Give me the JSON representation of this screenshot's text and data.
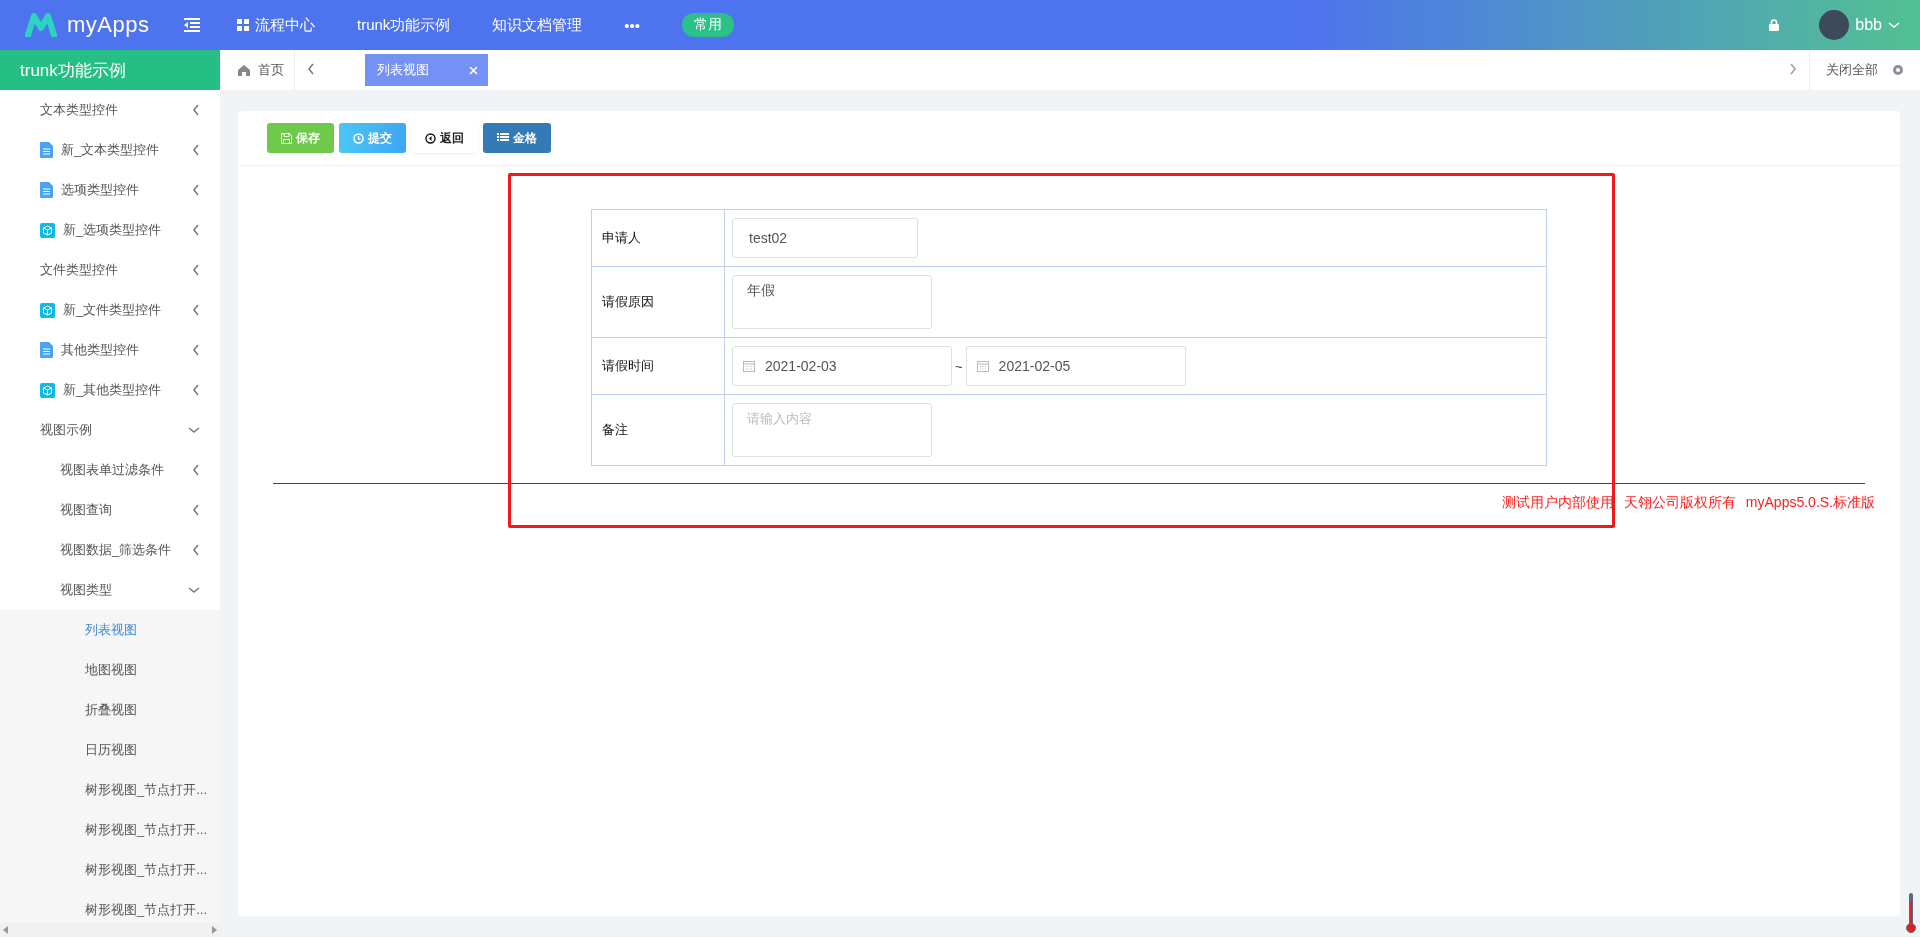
{
  "topbar": {
    "brand": "myApps",
    "nav": [
      {
        "kind": "grid",
        "label": "流程中心"
      },
      {
        "kind": "plain",
        "label": "trunk功能示例"
      },
      {
        "kind": "plain",
        "label": "知识文档管理"
      },
      {
        "kind": "plain",
        "label": "•••"
      }
    ],
    "badge": "常用",
    "user": "bbb"
  },
  "sidebar": {
    "title": "trunk功能示例",
    "items": [
      {
        "label": "文本类型控件",
        "expanded": false,
        "selected": false
      },
      {
        "kind": "doc",
        "label": "新_文本类型控件",
        "expanded": false,
        "selected": false
      },
      {
        "kind": "doc",
        "label": "选项类型控件",
        "expanded": false,
        "selected": false
      },
      {
        "kind": "cube",
        "label": "新_选项类型控件",
        "expanded": false,
        "selected": false
      },
      {
        "label": "文件类型控件",
        "expanded": false,
        "selected": false
      },
      {
        "kind": "cube",
        "label": "新_文件类型控件",
        "expanded": false,
        "selected": false
      },
      {
        "kind": "doc",
        "label": "其他类型控件",
        "expanded": false,
        "selected": false
      },
      {
        "kind": "cube",
        "label": "新_其他类型控件",
        "expanded": false,
        "selected": false
      },
      {
        "label": "视图示例",
        "expanded": true,
        "selected": false,
        "children": [
          {
            "label": "视图表单过滤条件",
            "expanded": false,
            "selected": false
          },
          {
            "label": "视图查询",
            "expanded": false,
            "selected": false
          },
          {
            "label": "视图数据_筛选条件",
            "expanded": false,
            "selected": false
          },
          {
            "label": "视图类型",
            "expanded": true,
            "selected": false,
            "children": [
              {
                "label": "列表视图",
                "selected": true
              },
              {
                "label": "地图视图",
                "selected": false
              },
              {
                "label": "折叠视图",
                "selected": false
              },
              {
                "label": "日历视图",
                "selected": false
              },
              {
                "label": "树形视图_节点打开...",
                "selected": false
              },
              {
                "label": "树形视图_节点打开...",
                "selected": false
              },
              {
                "label": "树形视图_节点打开...",
                "selected": false
              },
              {
                "label": "树形视图_节点打开...",
                "selected": false
              }
            ]
          }
        ]
      }
    ]
  },
  "tabs": {
    "home": "首页",
    "items": [
      {
        "label": "列表视图",
        "selected": true
      }
    ],
    "close_all": "关闭全部"
  },
  "toolbar": [
    {
      "kind": "save",
      "label": "保存"
    },
    {
      "kind": "submit",
      "label": "提交"
    },
    {
      "kind": "back",
      "label": "返回"
    },
    {
      "kind": "grid",
      "label": "金格"
    }
  ],
  "form": [
    {
      "kind": "text",
      "label": "申请人",
      "value": "test02"
    },
    {
      "kind": "textarea",
      "label": "请假原因",
      "value": "年假"
    },
    {
      "kind": "daterange",
      "label": "请假时间",
      "from": "2021-02-03",
      "separator": "~",
      "to": "2021-02-05"
    },
    {
      "kind": "textarea",
      "label": "备注",
      "placeholder": "请输入内容"
    }
  ],
  "footer": "测试用户内部使用 天翎公司版权所有 myApps5.0.S.标准版"
}
